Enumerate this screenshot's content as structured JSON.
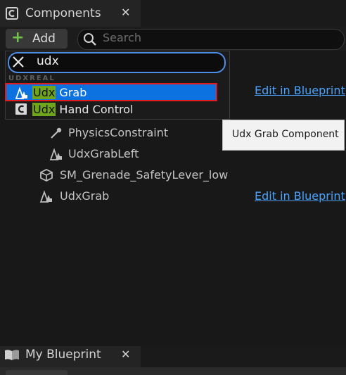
{
  "components_tab": {
    "title": "Components",
    "close": "✕",
    "icon": "blueprint-class-icon"
  },
  "toolbar": {
    "add_label": "Add",
    "add_icon": "plus-icon",
    "search_placeholder": "Search",
    "search_icon": "search-icon"
  },
  "add_menu": {
    "search_value": "udx",
    "clear_icon": "clear-x-icon",
    "category": "UDXREAL",
    "results": [
      {
        "highlight": "Udx",
        "rest": " Grab",
        "icon": "scene-component-icon",
        "selected": true
      },
      {
        "highlight": "Udx",
        "rest": " Hand Control",
        "icon": "class-c-icon",
        "selected": false
      }
    ]
  },
  "tree": {
    "rows": [
      {
        "label": "PhysicsConstraint",
        "icon": "physics-constraint-icon"
      },
      {
        "label": "UdxGrabLeft",
        "icon": "scene-component-icon"
      },
      {
        "label": "SM_Grenade_SafetyLever_low",
        "icon": "static-mesh-icon"
      },
      {
        "label": "UdxGrab",
        "icon": "scene-component-icon"
      }
    ],
    "edit_link_1": "Edit in Blueprint",
    "edit_link_2": "Edit in Blueprint"
  },
  "tooltip": {
    "text": "Udx Grab Component"
  },
  "my_blueprint_tab": {
    "title": "My Blueprint",
    "close": "✕",
    "icon": "book-icon"
  },
  "colors": {
    "selection": "#0b72e0",
    "match_highlight": "#6fa51a",
    "link": "#4aa3ff",
    "annotation_outline": "#e11a1a",
    "add_plus": "#71c04a"
  }
}
